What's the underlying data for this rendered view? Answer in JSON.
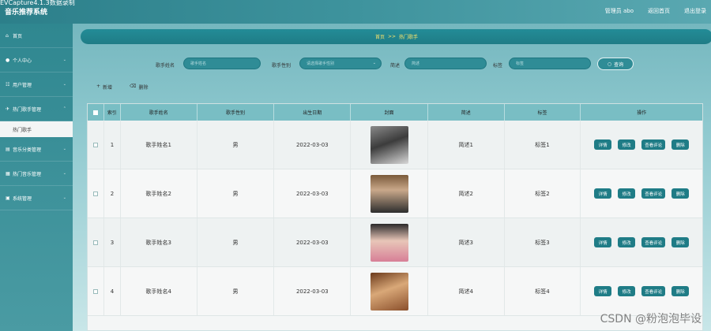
{
  "capture_label": "EVCapture4.1.3数据录制",
  "app_title": "音乐推荐系统",
  "topbar": {
    "user": "管理员 abo",
    "home_link": "返回首页",
    "logout": "退出登录"
  },
  "sidebar": {
    "items": [
      {
        "label": "首页",
        "icon": "⌂"
      },
      {
        "label": "个人中心",
        "icon": "●"
      },
      {
        "label": "用户管理",
        "icon": "☷"
      },
      {
        "label": "热门歌手管理",
        "icon": "✈",
        "sub": "热门歌手"
      },
      {
        "label": "音乐分类管理",
        "icon": "▤"
      },
      {
        "label": "热门音乐管理",
        "icon": "▦"
      },
      {
        "label": "系统管理",
        "icon": "▣"
      }
    ]
  },
  "breadcrumb": {
    "home": "首页",
    "sep": ">>",
    "current": "热门歌手"
  },
  "search": {
    "name_label": "歌手姓名",
    "name_placeholder": "歌手姓名",
    "gender_label": "歌手性别",
    "gender_placeholder": "请选择歌手性别",
    "desc_label": "简述",
    "desc_placeholder": "简述",
    "tag_label": "标签",
    "tag_placeholder": "标签",
    "button": "查询"
  },
  "actions": {
    "add": "新增",
    "delete": "删除"
  },
  "table": {
    "headers": [
      "索引",
      "歌手姓名",
      "歌手性别",
      "出生日期",
      "封面",
      "简述",
      "标签",
      "操作"
    ],
    "rows": [
      {
        "index": "1",
        "name": "歌手姓名1",
        "gender": "男",
        "date": "2022-03-03",
        "desc": "简述1",
        "tag": "标签1"
      },
      {
        "index": "2",
        "name": "歌手姓名2",
        "gender": "男",
        "date": "2022-03-03",
        "desc": "简述2",
        "tag": "标签2"
      },
      {
        "index": "3",
        "name": "歌手姓名3",
        "gender": "男",
        "date": "2022-03-03",
        "desc": "简述3",
        "tag": "标签3"
      },
      {
        "index": "4",
        "name": "歌手姓名4",
        "gender": "男",
        "date": "2022-03-03",
        "desc": "简述4",
        "tag": "标签4"
      }
    ],
    "op_labels": {
      "detail": "详情",
      "edit": "修改",
      "comments": "查看评论",
      "delete": "删除"
    }
  },
  "watermark": "CSDN @粉泡泡毕设"
}
